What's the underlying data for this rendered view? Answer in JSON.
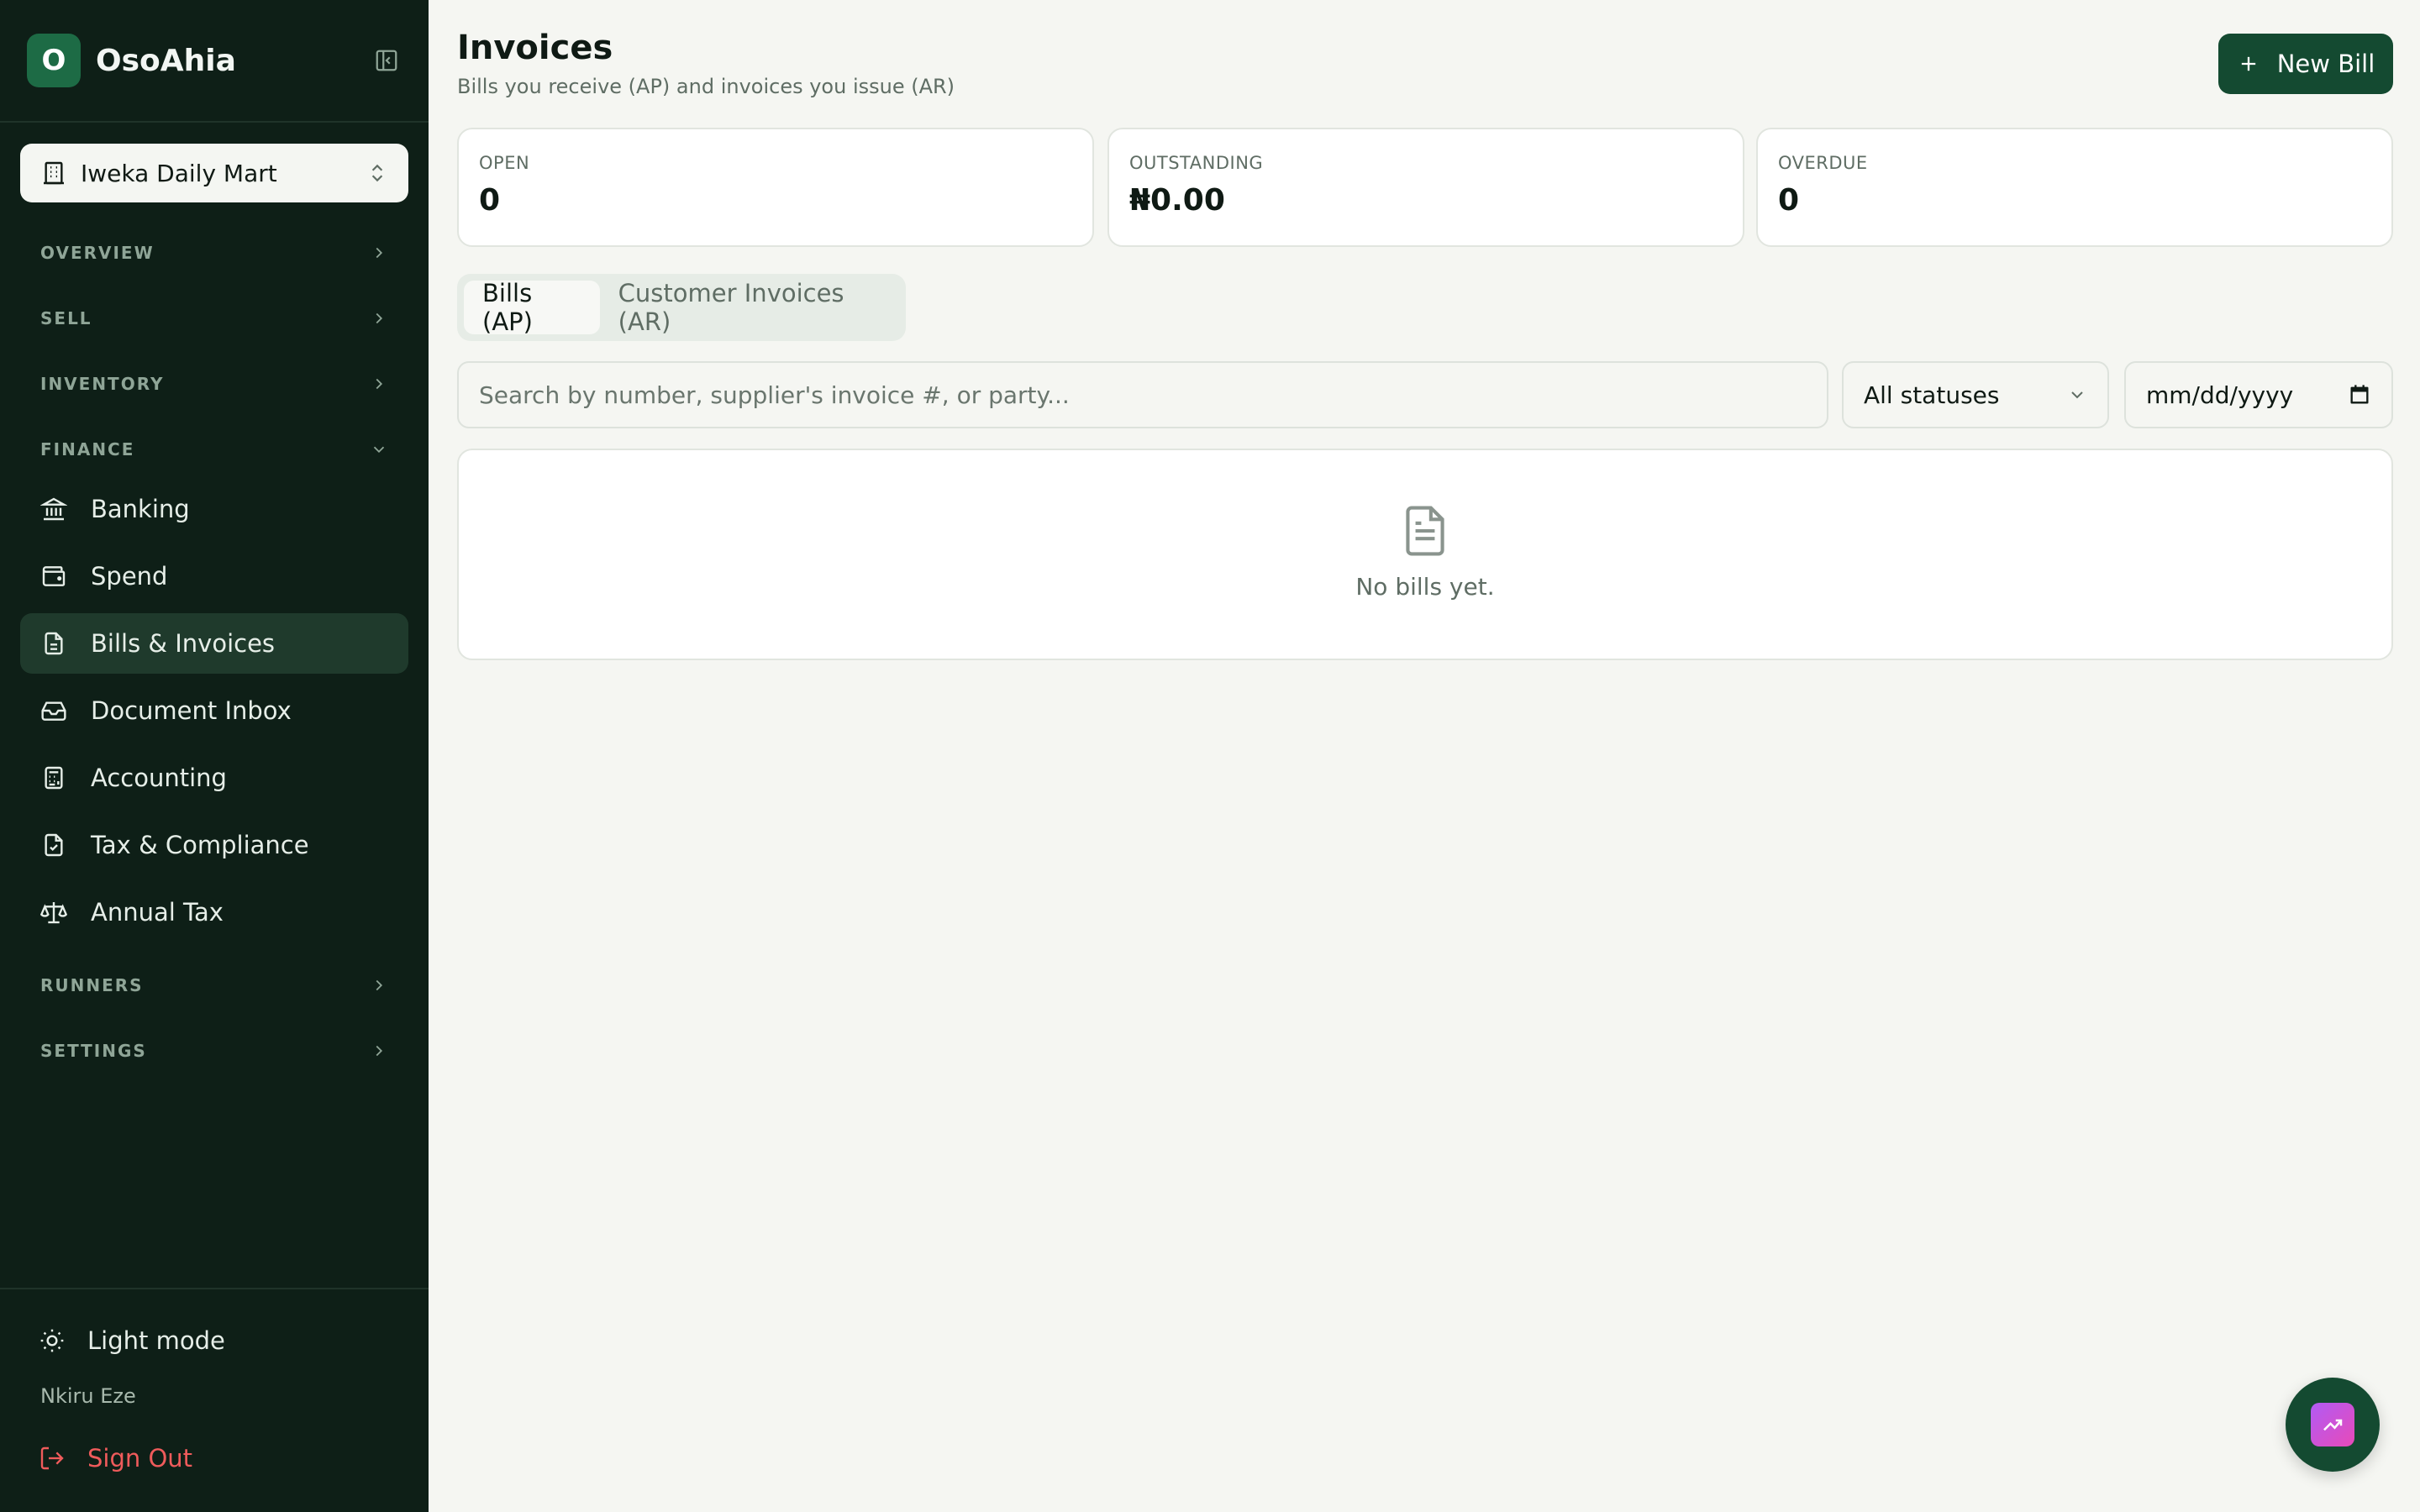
{
  "brand": {
    "logo_letter": "O",
    "name": "OsoAhia"
  },
  "workspace": {
    "name": "Iweka Daily Mart"
  },
  "sidebar": {
    "sections": {
      "overview": "OVERVIEW",
      "sell": "SELL",
      "inventory": "INVENTORY",
      "finance": "FINANCE",
      "runners": "RUNNERS",
      "settings": "SETTINGS"
    },
    "finance_items": [
      {
        "label": "Banking",
        "icon": "bank-icon"
      },
      {
        "label": "Spend",
        "icon": "wallet-icon"
      },
      {
        "label": "Bills & Invoices",
        "icon": "receipt-icon",
        "active": true
      },
      {
        "label": "Document Inbox",
        "icon": "inbox-icon"
      },
      {
        "label": "Accounting",
        "icon": "calculator-icon"
      },
      {
        "label": "Tax & Compliance",
        "icon": "file-check-icon"
      },
      {
        "label": "Annual Tax",
        "icon": "scale-icon"
      }
    ],
    "footer": {
      "theme_label": "Light mode",
      "user_name": "Nkiru Eze",
      "sign_out_label": "Sign Out"
    }
  },
  "page": {
    "title": "Invoices",
    "subtitle": "Bills you receive (AP) and invoices you issue (AR)",
    "new_button_label": "New Bill"
  },
  "stats": [
    {
      "label": "OPEN",
      "value": "0"
    },
    {
      "label": "OUTSTANDING",
      "value": "₦0.00"
    },
    {
      "label": "OVERDUE",
      "value": "0"
    }
  ],
  "tabs": [
    {
      "label": "Bills (AP)",
      "active": true
    },
    {
      "label": "Customer Invoices (AR)",
      "active": false
    }
  ],
  "filters": {
    "search_placeholder": "Search by number, supplier's invoice #, or party...",
    "search_value": "",
    "status_selected": "All statuses",
    "date_placeholder": "mm/dd/yyyy"
  },
  "empty_state": {
    "message": "No bills yet."
  },
  "colors": {
    "sidebar_bg": "#0e1f17",
    "accent": "#144a31",
    "active_nav": "#1f3a2c",
    "danger": "#ef5b5b"
  }
}
